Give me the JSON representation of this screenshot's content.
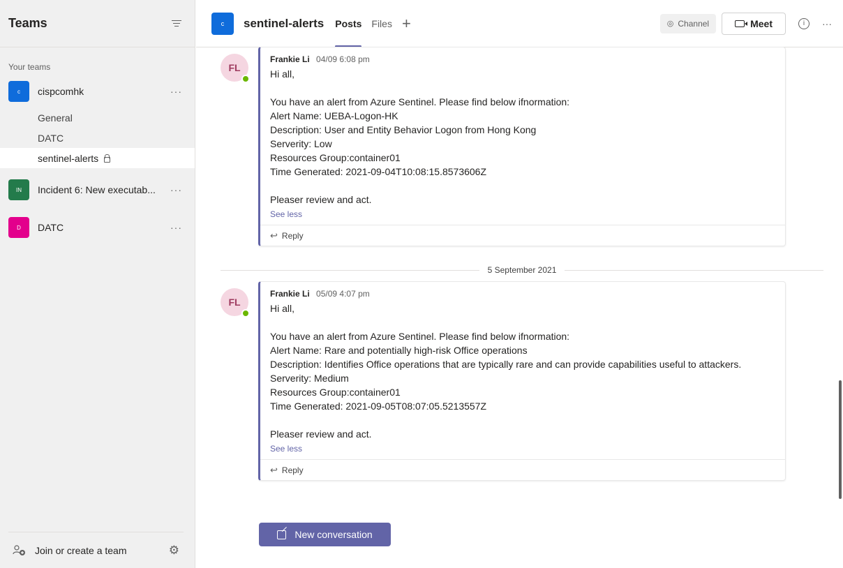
{
  "sidebar": {
    "title": "Teams",
    "section_label": "Your teams",
    "teams": [
      {
        "initials": "c",
        "name": "cispcomhk",
        "color": "#0f6cdb",
        "channels": [
          "General",
          "DATC",
          "sentinel-alerts"
        ]
      },
      {
        "initials": "IN",
        "name": "Incident 6: New executab...",
        "color": "#237b4b"
      },
      {
        "initials": "D",
        "name": "DATC",
        "color": "#e3008c"
      }
    ],
    "more_glyph": "···",
    "footer": {
      "join_label": "Join or create a team"
    }
  },
  "header": {
    "channel_initial": "c",
    "channel_name": "sentinel-alerts",
    "tabs": [
      "Posts",
      "Files"
    ],
    "add_tab": "+",
    "channel_button": "Channel",
    "meet_button": "Meet",
    "info_glyph": "i",
    "more_glyph": "···"
  },
  "messages": [
    {
      "initials": "FL",
      "author": "Frankie Li",
      "time": "04/09 6:08 pm",
      "lines": [
        "Hi all,",
        "",
        "You have an alert from Azure Sentinel. Please find below ifnormation:",
        "Alert Name: UEBA-Logon-HK",
        "Description: User and Entity Behavior Logon from Hong Kong",
        "Serverity: Low",
        "Resources Group:container01",
        "Time Generated: 2021-09-04T10:08:15.8573606Z",
        "",
        "Pleaser review and act."
      ],
      "see_less": "See less",
      "reply": "Reply"
    },
    {
      "initials": "FL",
      "author": "Frankie Li",
      "time": "05/09 4:07 pm",
      "lines": [
        "Hi all,",
        "",
        "You have an alert from Azure Sentinel. Please find below ifnormation:",
        "Alert Name: Rare and potentially high-risk Office operations",
        "Description: Identifies Office operations that are typically rare and can provide capabilities useful to attackers.",
        "Serverity: Medium",
        "Resources Group:container01",
        "Time Generated: 2021-09-05T08:07:05.5213557Z",
        "",
        "Pleaser review and act."
      ],
      "see_less": "See less",
      "reply": "Reply"
    }
  ],
  "date_divider": "5 September 2021",
  "new_conversation": "New conversation",
  "colors": {
    "accent": "#6264a7",
    "presence": "#6bb700",
    "avatar_bg": "#f5d6e1"
  }
}
